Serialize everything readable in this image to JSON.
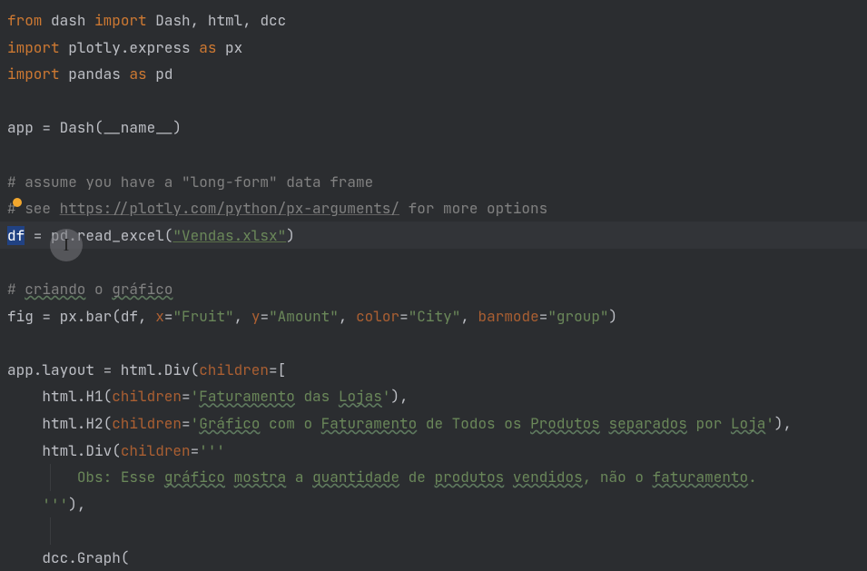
{
  "code": {
    "l1": {
      "from": "from",
      "dash": "dash",
      "import": "import",
      "items": "Dash, html, dcc"
    },
    "l2": {
      "import": "import",
      "mod": "plotly.express",
      "as": "as",
      "alias": "px"
    },
    "l3": {
      "import": "import",
      "mod": "pandas",
      "as": "as",
      "alias": "pd"
    },
    "l5": {
      "text": "app = Dash(__name__)"
    },
    "l7": {
      "text": "# assume you have a \"long-form\" data frame"
    },
    "l8": {
      "pre": "# see ",
      "url": "https://plotly.com/python/px-arguments/",
      "post": " for more options"
    },
    "l9": {
      "sel": "df",
      "rest": " = pd.read_excel(",
      "str": "\"Vendas.xlsx\"",
      "close": ")"
    },
    "l11": {
      "pre": "# ",
      "w1": "criando",
      "mid": " o ",
      "w2": "gráfico"
    },
    "l12": {
      "pre": "fig = px.bar(",
      "df": "df",
      "c1": ", ",
      "a1": "x",
      "e1": "=",
      "s1": "\"Fruit\"",
      "c2": ", ",
      "a2": "y",
      "e2": "=",
      "s2": "\"Amount\"",
      "c3": ", ",
      "a3": "color",
      "e3": "=",
      "s3": "\"City\"",
      "c4": ", ",
      "a4": "barmode",
      "e4": "=",
      "s4": "\"group\"",
      "close": ")"
    },
    "l14": {
      "text": "app.layout = html.Div(",
      "arg": "children",
      "eq": "=["
    },
    "l15": {
      "pre": "    html.H1(",
      "arg": "children",
      "eq": "=",
      "q": "'",
      "w1": "Faturamento",
      "mid": " das ",
      "w2": "Lojas",
      "q2": "'",
      "close": "),"
    },
    "l16": {
      "pre": "    html.H2(",
      "arg": "children",
      "eq": "=",
      "q": "'",
      "w1": "Gráfico",
      "t1": " com o ",
      "w2": "Faturamento",
      "t2": " de Todos os ",
      "w3": "Produtos",
      "t3": " ",
      "w4": "separados",
      "t4": " por ",
      "w5": "Loja",
      "q2": "'",
      "close": "),"
    },
    "l17": {
      "pre": "    html.Div(",
      "arg": "children",
      "eq": "=",
      "q": "'''"
    },
    "l18": {
      "indent": "        ",
      "t1": "Obs: Esse ",
      "w1": "gráfico",
      "t2": " ",
      "w2": "mostra",
      "t3": " a ",
      "w3": "quantidade",
      "t4": " de ",
      "w4": "produtos",
      "t5": " ",
      "w5": "vendidos",
      "t6": ", não o ",
      "w6": "faturamento",
      "t7": "."
    },
    "l19": {
      "pre": "    ",
      "q": "'''",
      "close": "),"
    },
    "l21": {
      "text": "    dcc.Graph("
    }
  }
}
